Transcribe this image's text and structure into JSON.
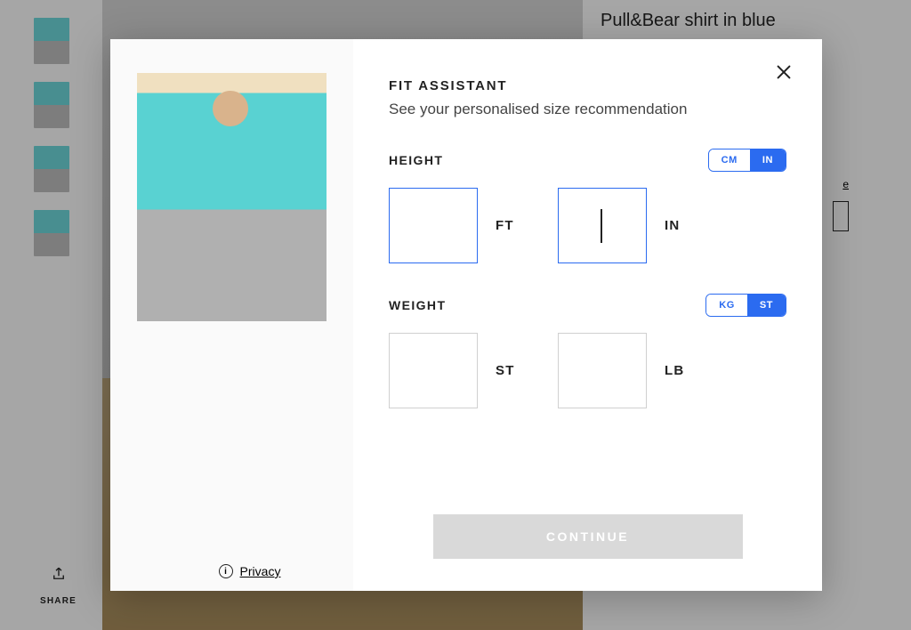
{
  "background": {
    "product_title": "Pull&Bear shirt in blue",
    "share_label": "SHARE",
    "size_guide_link": "e"
  },
  "modal": {
    "title": "FIT ASSISTANT",
    "subtitle": "See your personalised size recommendation",
    "close_icon_name": "close-icon",
    "privacy_label": "Privacy",
    "continue_label": "CONTINUE",
    "height": {
      "label": "HEIGHT",
      "unit_options": {
        "cm": "CM",
        "in": "IN"
      },
      "unit_selected": "IN",
      "input1_label": "FT",
      "input2_label": "IN",
      "ft_value": "",
      "in_value": "|"
    },
    "weight": {
      "label": "WEIGHT",
      "unit_options": {
        "kg": "KG",
        "st": "ST"
      },
      "unit_selected": "ST",
      "input1_label": "ST",
      "input2_label": "LB",
      "st_value": "",
      "lb_value": ""
    }
  }
}
